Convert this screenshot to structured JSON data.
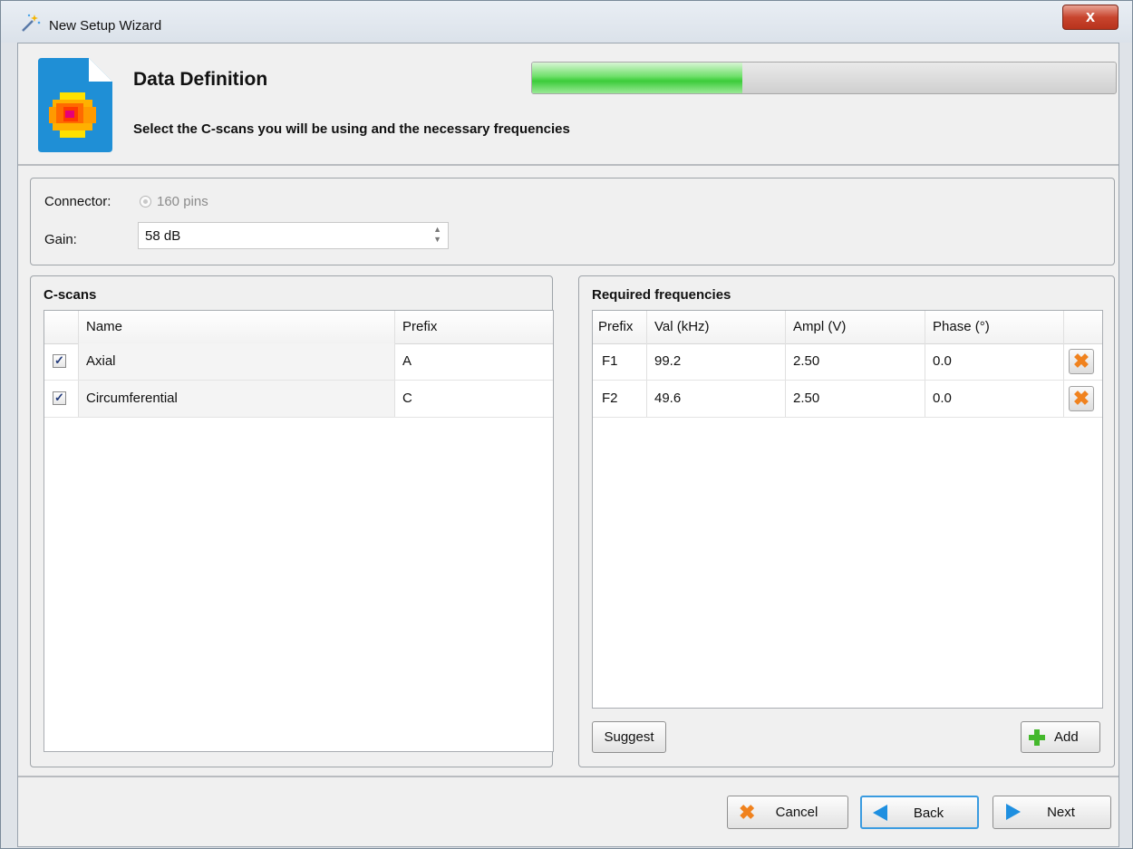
{
  "window": {
    "title": "New Setup Wizard",
    "close_label": "x"
  },
  "header": {
    "title": "Data Definition",
    "subtitle": "Select the C-scans you will be using and the necessary frequencies",
    "progress_fraction": 0.36
  },
  "connector": {
    "label": "Connector:",
    "value": "160 pins"
  },
  "gain": {
    "label": "Gain:",
    "value": "58 dB"
  },
  "cscans": {
    "title": "C-scans",
    "columns": [
      "Name",
      "Prefix"
    ],
    "rows": [
      {
        "checked": true,
        "name": "Axial",
        "prefix": "A"
      },
      {
        "checked": true,
        "name": "Circumferential",
        "prefix": "C"
      }
    ]
  },
  "frequencies": {
    "title": "Required frequencies",
    "columns": [
      "Prefix",
      "Val (kHz)",
      "Ampl (V)",
      "Phase (°)"
    ],
    "rows": [
      {
        "prefix": "F1",
        "val": "99.2",
        "ampl": "2.50",
        "phase": "0.0"
      },
      {
        "prefix": "F2",
        "val": "49.6",
        "ampl": "2.50",
        "phase": "0.0"
      }
    ],
    "suggest_label": "Suggest",
    "add_label": "Add"
  },
  "footer": {
    "cancel_label": "Cancel",
    "back_label": "Back",
    "next_label": "Next"
  },
  "colors": {
    "accent_blue": "#1e8fe0",
    "progress_green": "#3ccc3a",
    "delete_orange": "#f0821e",
    "close_red": "#c8452e"
  },
  "icons": {
    "wizard": "magic-wand-icon",
    "file": "file-heatmap-icon",
    "delete": "x-icon",
    "add": "plus-icon",
    "cancel": "x-icon",
    "back": "arrow-left-icon",
    "next": "arrow-right-icon"
  }
}
